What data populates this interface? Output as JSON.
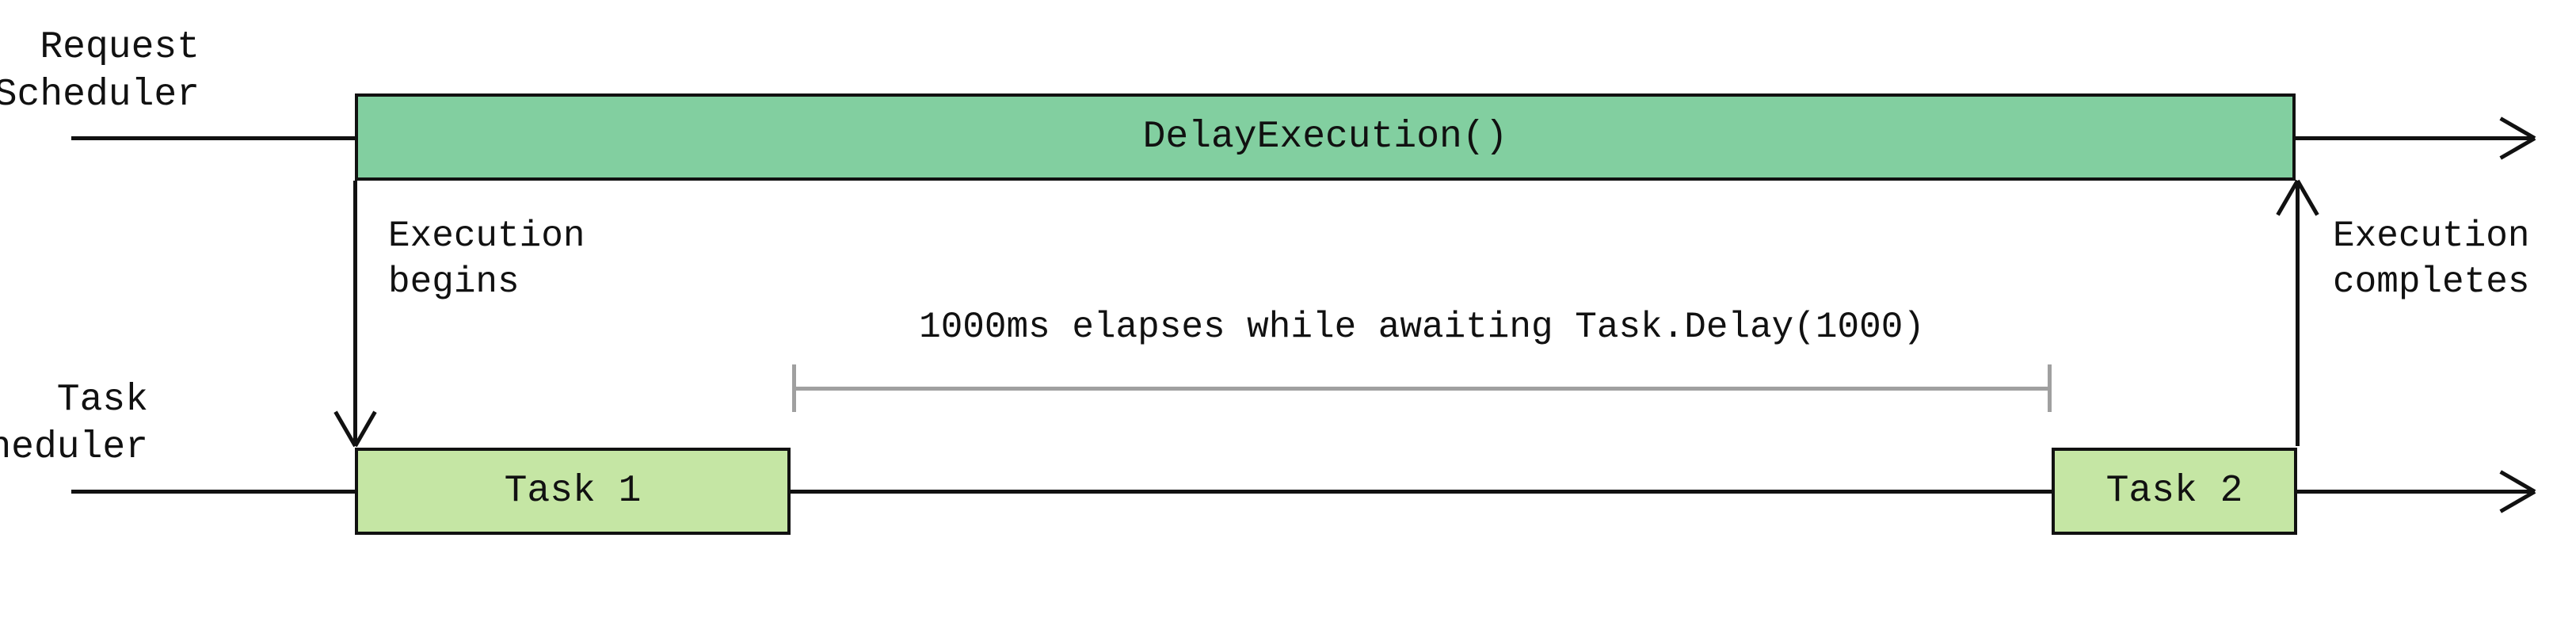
{
  "lanes": {
    "request_scheduler": "Request\nScheduler",
    "task_scheduler": "Task\nScheduler"
  },
  "bars": {
    "delay_execution": "DelayExecution()",
    "task1": "Task 1",
    "task2": "Task 2"
  },
  "notes": {
    "execution_begins": "Execution\nbegins",
    "execution_completes": "Execution\ncompletes",
    "elapses": "1000ms elapses while awaiting Task.Delay(1000)"
  },
  "colors": {
    "bar_green": "#82cfa0",
    "bar_lime": "#c5e6a4",
    "axis": "#111111",
    "timespan": "#a0a0a0"
  }
}
